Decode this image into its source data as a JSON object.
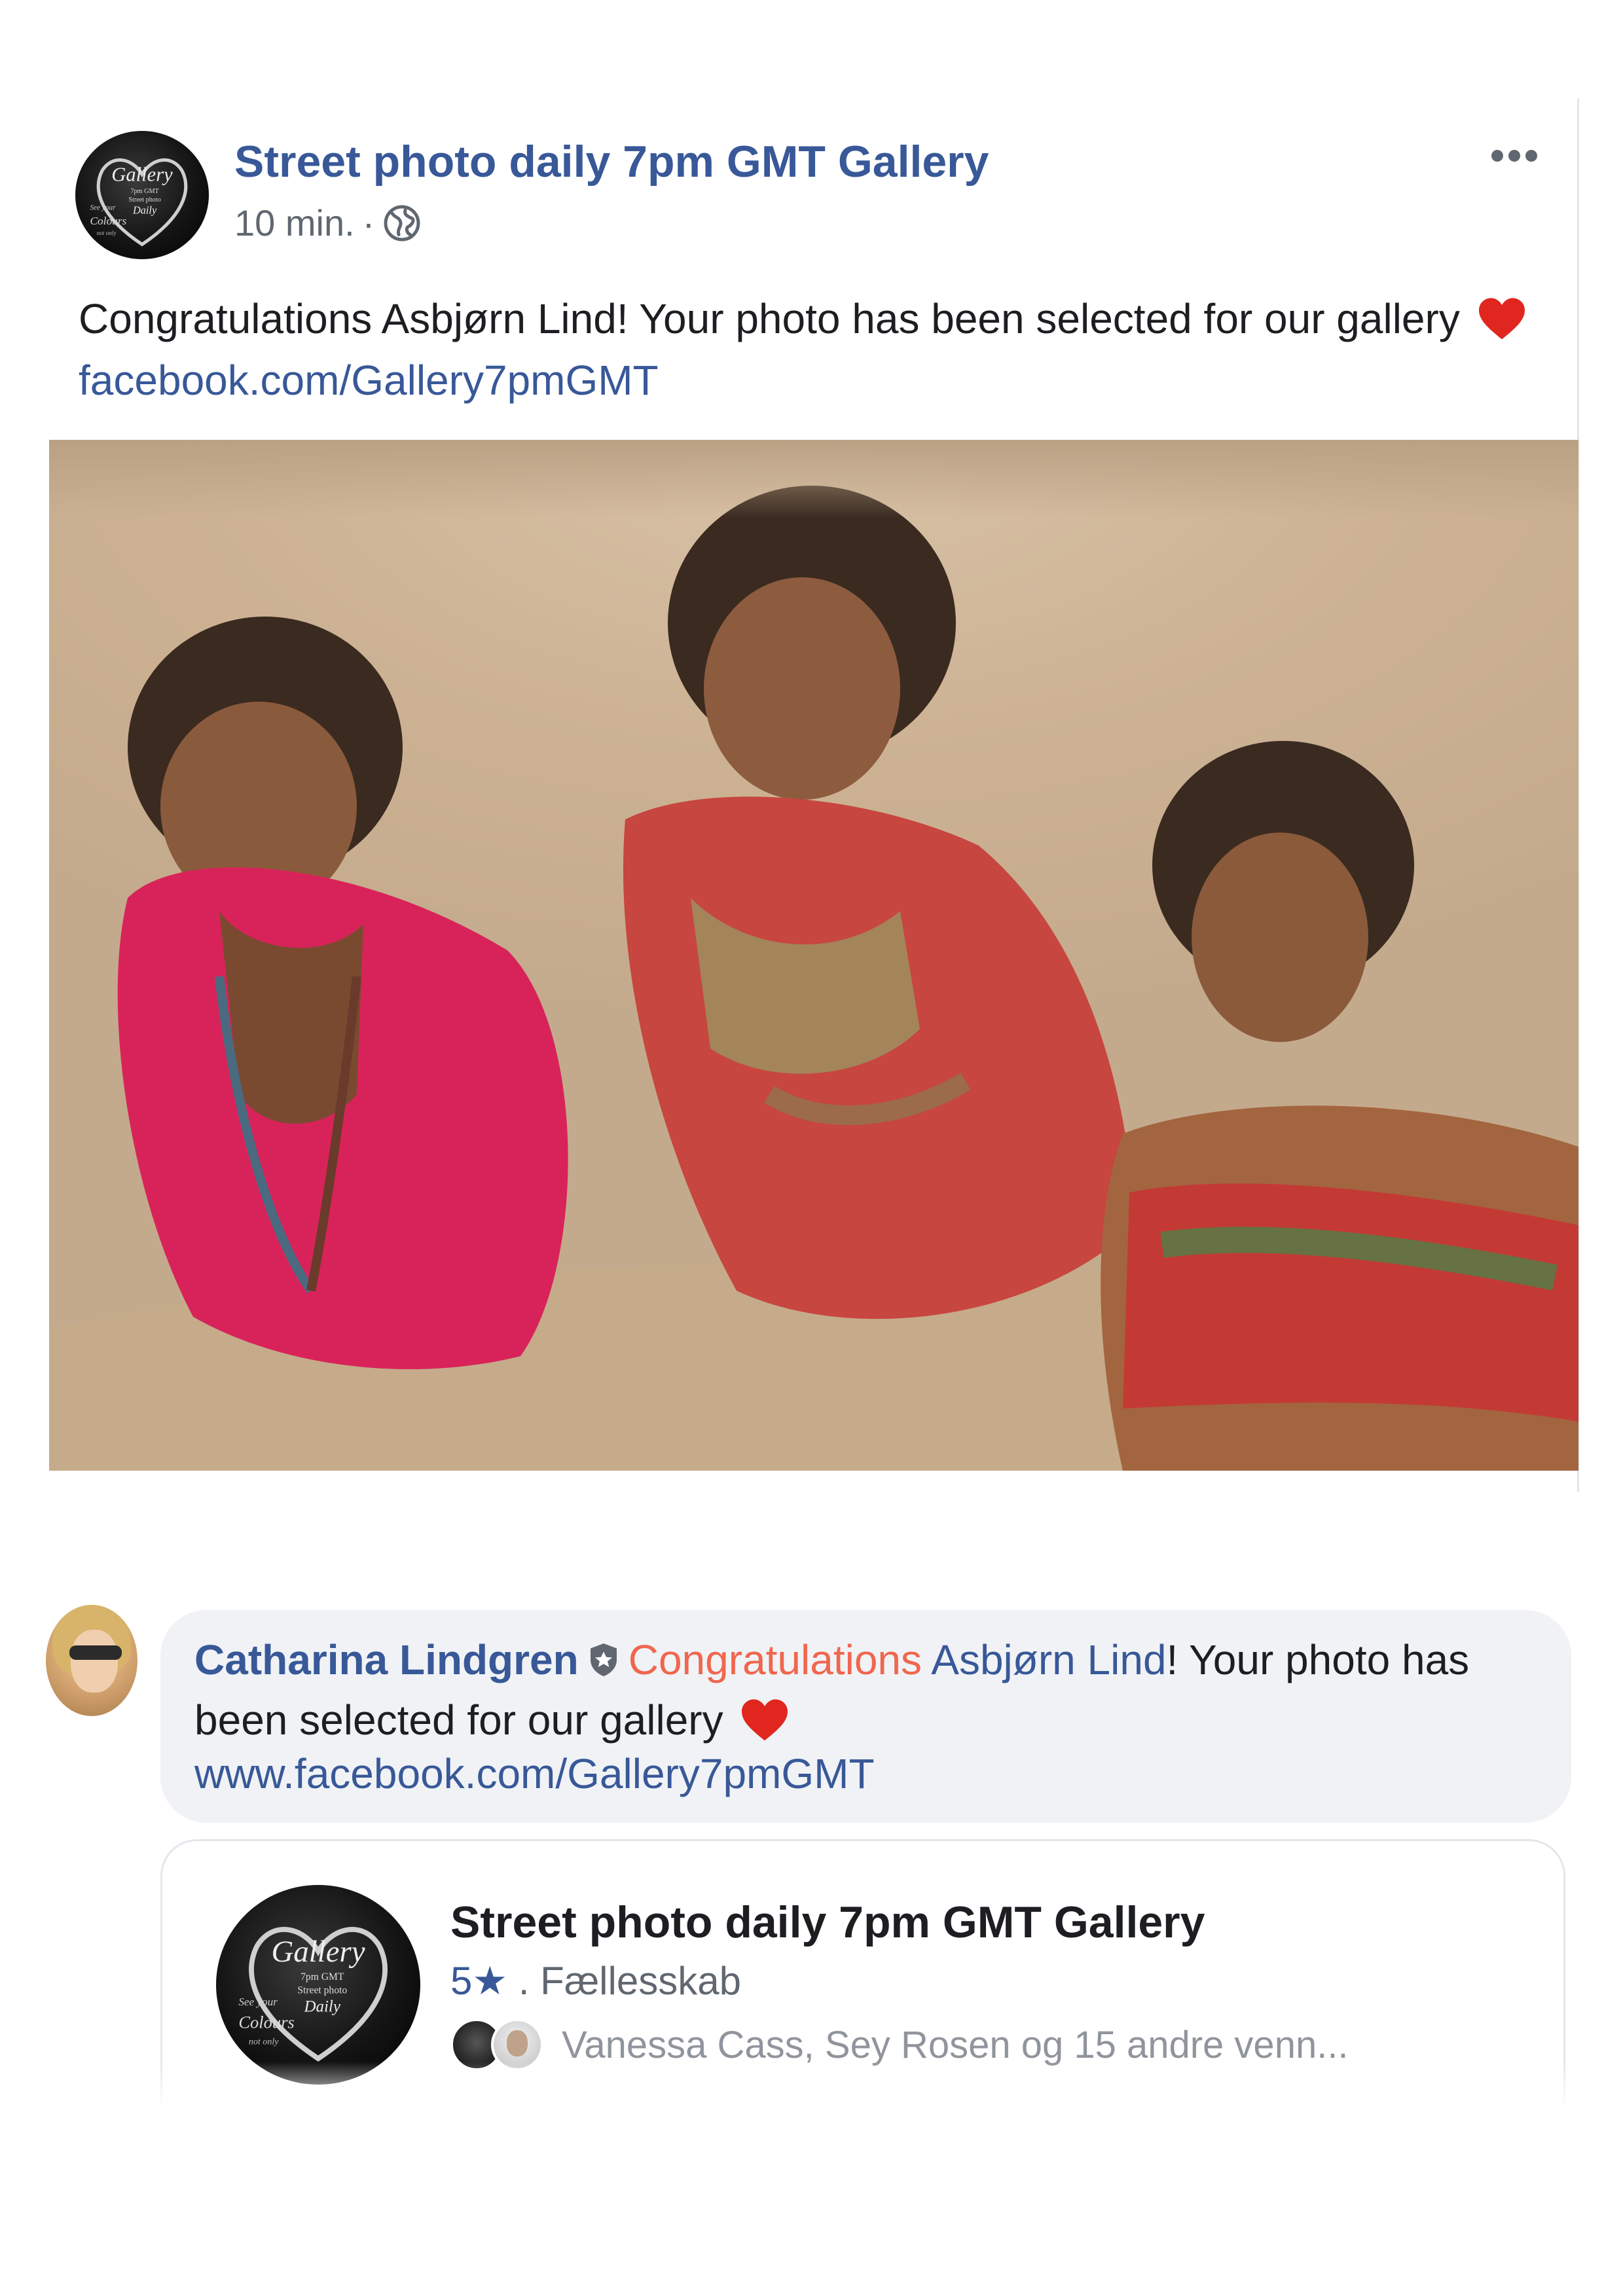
{
  "post": {
    "page_name": "Street photo daily 7pm GMT Gallery",
    "time": "10 min.",
    "separator": "·",
    "text_before_link": "Congratulations Asbjørn Lind! Your photo has been selected for our gallery",
    "link": "facebook.com/Gallery7pmGMT",
    "more_icon": "more-horizontal-icon",
    "privacy_icon": "globe-icon"
  },
  "logo": {
    "title": "Gallery",
    "sub1": "7pm GMT",
    "sub2": "Street photo",
    "sub3": "Daily",
    "side1": "See your",
    "side2": "Colours",
    "side3": "not only"
  },
  "comment": {
    "author": "Catharina Lindgren",
    "word_congrats": "Congratulations",
    "tagged_name": "Asbjørn Lind",
    "text_after_tag": "! Your photo has been selected for our gallery",
    "link": "www.facebook.com/Gallery7pmGMT"
  },
  "card": {
    "title": "Street photo daily 7pm GMT Gallery",
    "rating": "5★",
    "category": " . Fællesskab",
    "friends": "Vanessa Cass, Sey Rosen og 15 andre venn..."
  },
  "colors": {
    "link_blue": "#385898",
    "mention_red": "#f0664e",
    "heart_red": "#e0261f"
  }
}
